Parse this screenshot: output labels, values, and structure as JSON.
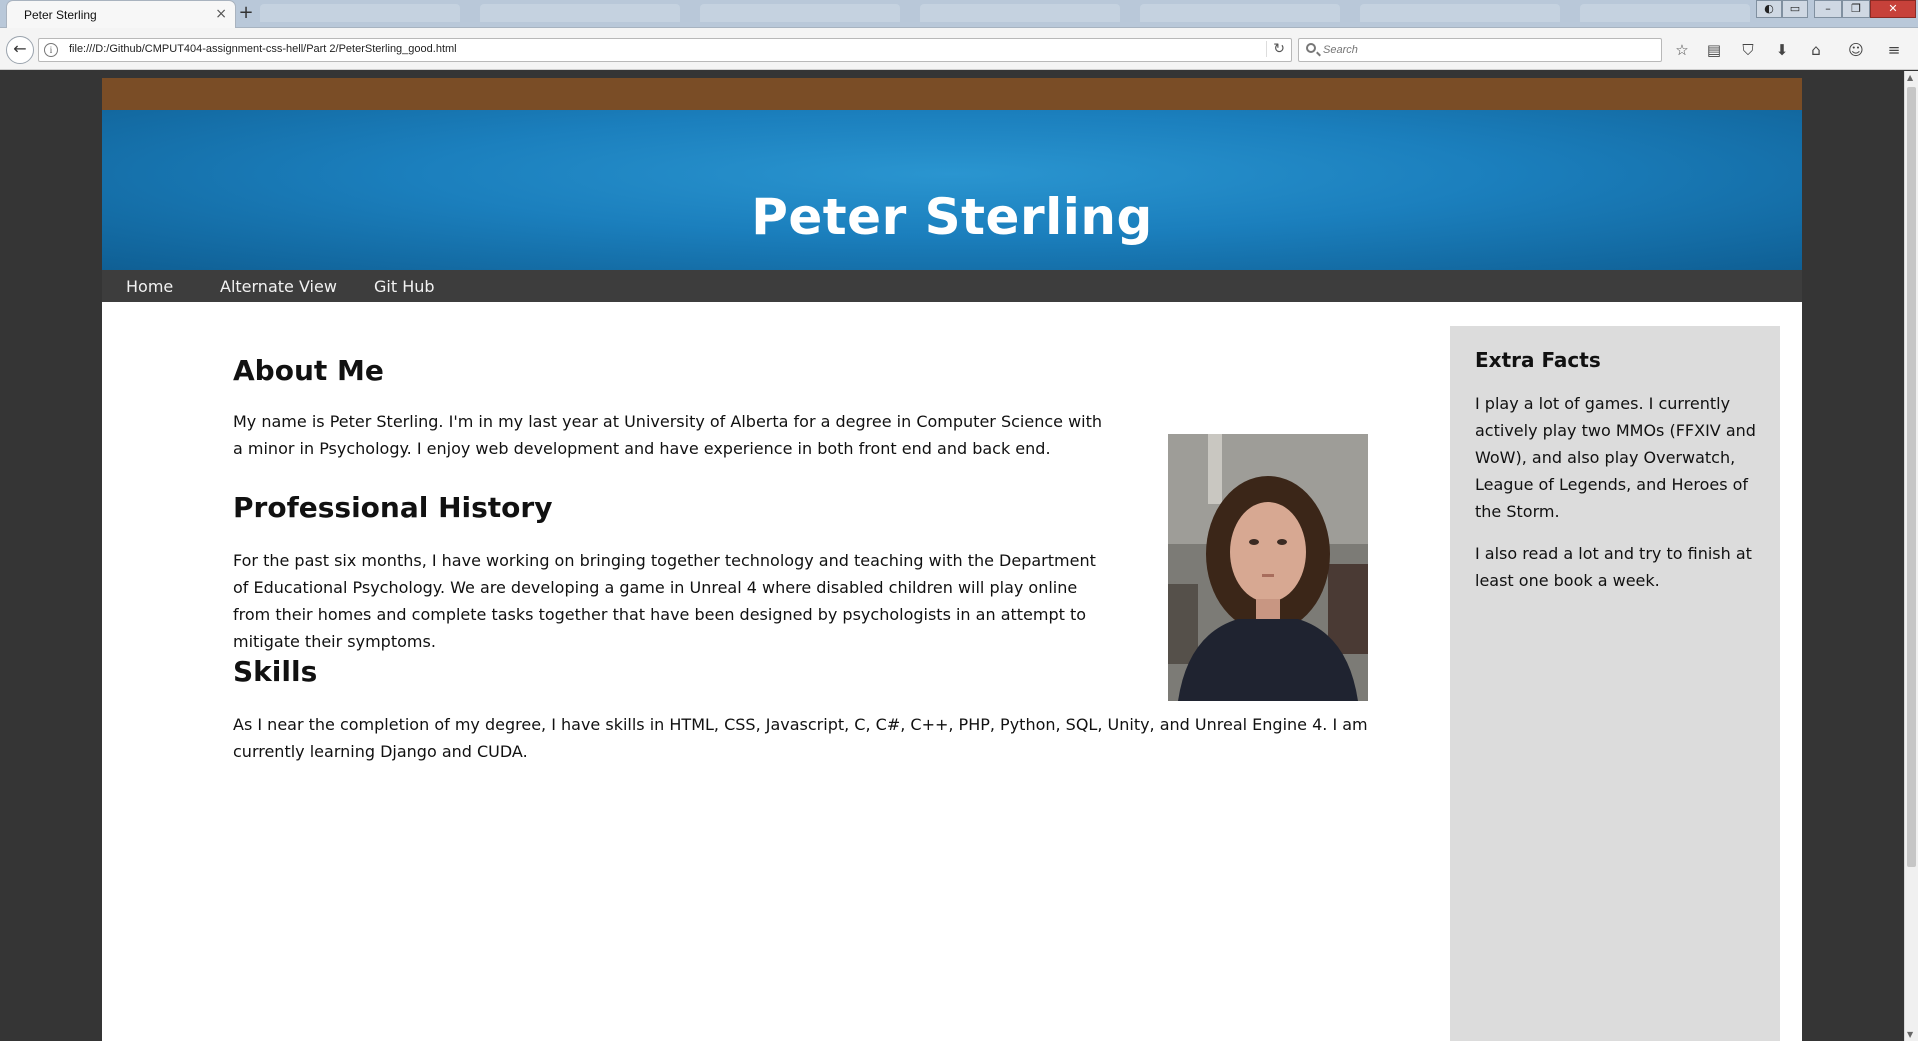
{
  "browser": {
    "tab_title": "Peter Sterling",
    "url": "file:///D:/Github/CMPUT404-assignment-css-hell/Part 2/PeterSterling_good.html",
    "search_placeholder": "Search"
  },
  "site": {
    "title": "Peter Sterling",
    "nav": [
      "Home",
      "Alternate View",
      "Git Hub"
    ]
  },
  "main": {
    "about_heading": "About Me",
    "about_text": "My name is Peter Sterling. I'm in my last year at University of Alberta for a degree in Computer Science with a minor in Psychology. I enjoy web development and have experience in both front end and back end.",
    "history_heading": "Professional History",
    "history_text": "For the past six months, I have working on bringing together technology and teaching with the Department of Educational Psychology. We are developing a game in Unreal 4 where disabled children will play online from their homes and complete tasks together that have been designed by psychologists in an attempt to mitigate their symptoms.",
    "skills_heading": "Skills",
    "skills_text": "As I near the completion of my degree, I have skills in HTML, CSS, Javascript, C, C#, C++, PHP, Python, SQL, Unity, and Unreal Engine 4. I am currently learning Django and CUDA."
  },
  "sidebar": {
    "heading": "Extra Facts",
    "para1": "I play a lot of games. I currently actively play two MMOs (FFXIV and WoW), and also play Overwatch, League of Legends, and Heroes of the Storm.",
    "para2": "I also read a lot and try to finish at least one book a week."
  },
  "colors": {
    "brown_bar": "#7a4d26",
    "banner_blue": "#1b7fbd",
    "nav_bar": "#3d3d3d",
    "sidebar_bg": "#dcdcdc",
    "outer_bg": "#353535"
  },
  "icons": [
    "info-icon",
    "reload-icon",
    "search-icon",
    "bookmark-star-icon",
    "reading-list-icon",
    "pocket-icon",
    "download-icon",
    "home-icon",
    "chat-icon",
    "menu-icon"
  ]
}
